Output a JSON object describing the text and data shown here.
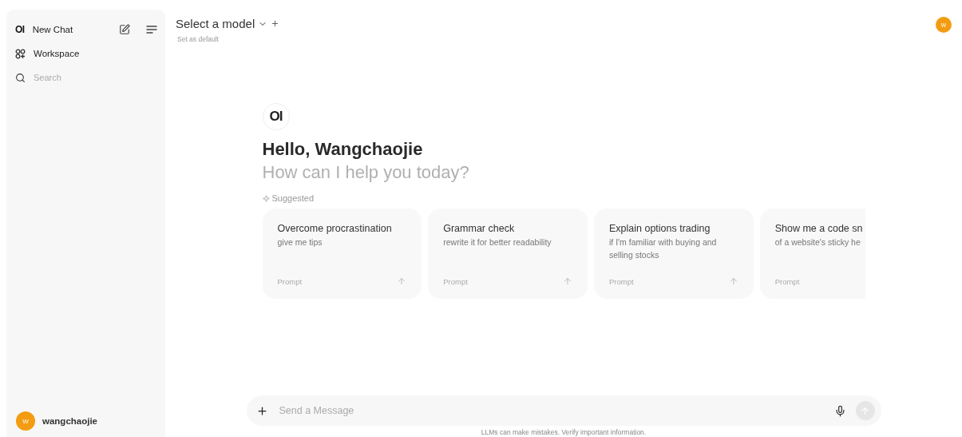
{
  "sidebar": {
    "logo": "OI",
    "new_chat": "New Chat",
    "items": [
      {
        "label": "Workspace"
      }
    ],
    "search": {
      "placeholder": "Search"
    },
    "user": {
      "initial": "W",
      "name": "wangchaojie"
    }
  },
  "header": {
    "model_select": "Select a model",
    "set_default": "Set as default",
    "avatar": "W"
  },
  "welcome": {
    "logo": "OI",
    "title": "Hello, Wangchaojie",
    "subtitle": "How can I help you today?",
    "suggested_label": "Suggested"
  },
  "suggestions": [
    {
      "title": "Overcome procrastination",
      "subtitle": "give me tips",
      "tag": "Prompt",
      "cut": false
    },
    {
      "title": "Grammar check",
      "subtitle": "rewrite it for better readability",
      "tag": "Prompt",
      "cut": false
    },
    {
      "title": "Explain options trading",
      "subtitle": "if I'm familiar with buying and selling stocks",
      "tag": "Prompt",
      "cut": false
    },
    {
      "title": "Show me a code sn",
      "subtitle": "of a website's sticky he",
      "tag": "Prompt",
      "cut": true
    }
  ],
  "composer": {
    "placeholder": "Send a Message"
  },
  "footer_note": "LLMs can make mistakes. Verify important information."
}
